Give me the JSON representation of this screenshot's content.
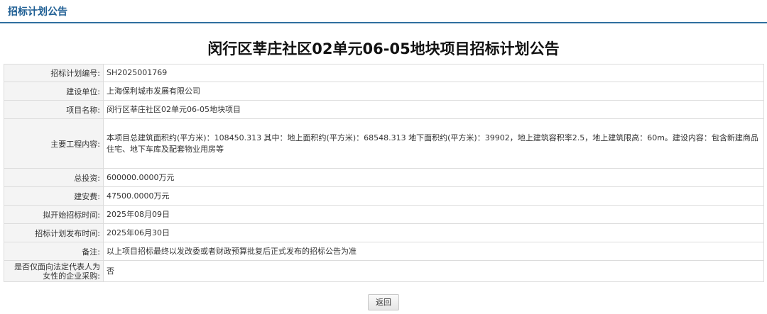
{
  "header": {
    "title": "招标计划公告"
  },
  "page_title": "闵行区莘庄社区02单元06-05地块项目招标计划公告",
  "rows": [
    {
      "label": "招标计划编号:",
      "value": "SH2025001769"
    },
    {
      "label": "建设单位:",
      "value": "上海保利城市发展有限公司"
    },
    {
      "label": "项目名称:",
      "value": "闵行区莘庄社区02单元06-05地块项目"
    },
    {
      "label": "主要工程内容:",
      "value": "本项目总建筑面积约(平方米)：108450.313 其中：地上面积约(平方米)：68548.313 地下面积约(平方米)：39902，地上建筑容积率2.5，地上建筑限高：60m。建设内容：包含新建商品住宅、地下车库及配套物业用房等"
    },
    {
      "label": "总投资:",
      "value": "600000.0000万元"
    },
    {
      "label": "建安费:",
      "value": "47500.0000万元"
    },
    {
      "label": "拟开始招标时间:",
      "value": "2025年08月09日"
    },
    {
      "label": "招标计划发布时间:",
      "value": "2025年06月30日"
    },
    {
      "label": "备注:",
      "value": "以上项目招标最终以发改委或者财政预算批复后正式发布的招标公告为准"
    },
    {
      "label": "是否仅面向法定代表人为女性的企业采购:",
      "value": "否"
    }
  ],
  "footer": {
    "back_label": "返回"
  }
}
